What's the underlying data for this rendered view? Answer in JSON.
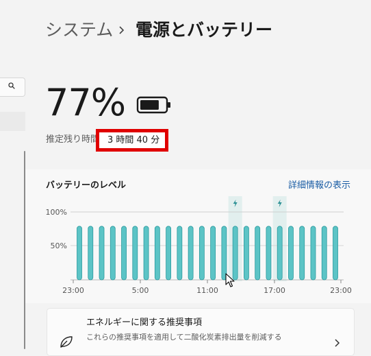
{
  "breadcrumb": {
    "parent": "システム",
    "current": "電源とバッテリー"
  },
  "battery": {
    "percent_text": "77%",
    "level": 0.77,
    "estimate_label": "推定残り時間",
    "estimate_value": "3 時間 40 分"
  },
  "chart_section": {
    "title": "バッテリーのレベル",
    "details_link": "詳細情報の表示"
  },
  "chart_data": {
    "type": "bar",
    "ylim": [
      0,
      100
    ],
    "y_ticks": [
      "100%",
      "50%"
    ],
    "x_ticks": [
      "23:00",
      "5:00",
      "11:00",
      "17:00",
      "23:00"
    ],
    "values": [
      79,
      79,
      79,
      79,
      79,
      79,
      79,
      79,
      79,
      79,
      79,
      79,
      79,
      79,
      79,
      79,
      79,
      79,
      79,
      79,
      79,
      79,
      79,
      79
    ],
    "charging_indices": [
      14,
      18
    ],
    "grid": true,
    "legend": "none"
  },
  "recommendation": {
    "title": "エネルギーに関する推奨事項",
    "subtitle": "これらの推奨事項を適用して二酸化炭素排出量を削減する"
  },
  "icons": {
    "search": "search-icon",
    "battery": "battery-icon",
    "charging": "lightning-icon",
    "leaf": "leaf-icon",
    "chevron": "chevron-right-icon",
    "cursor": "mouse-cursor-icon"
  },
  "colors": {
    "bar": "#5cc4c6",
    "bar_edge": "#2b9a9e",
    "charging_band": "#e2efee",
    "charging_icon": "#2a8f93",
    "link": "#1c5ea5",
    "highlight_border": "#e00000"
  }
}
